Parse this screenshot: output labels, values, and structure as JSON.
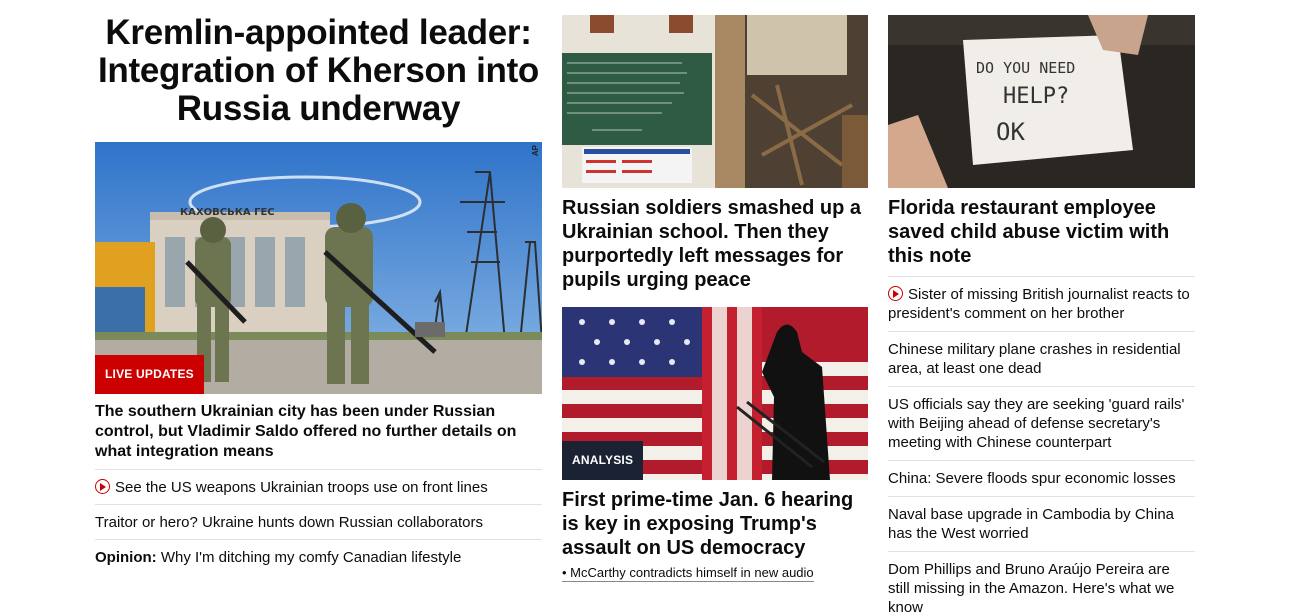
{
  "left": {
    "headline": "Kremlin-appointed leader: Integration of Kherson into Russia underway",
    "badge": "LIVE UPDATES",
    "photo_credit": "AP",
    "photo_sign": "КАХОВСЬКА ГЕС",
    "description": "The southern Ukrainian city has been under Russian control, but Vladimir Saldo offered no further details on what integration means",
    "links": [
      {
        "text": "See the US weapons Ukrainian troops use on front lines",
        "video": true
      },
      {
        "text": "Traitor or hero? Ukraine hunts down Russian collaborators",
        "video": false
      },
      {
        "prefix": "Opinion:",
        "text": " Why I'm ditching my comfy Canadian lifestyle",
        "video": false
      }
    ]
  },
  "middle": {
    "story1": {
      "title": "Russian soldiers smashed up a Ukrainian school. Then they purportedly left messages for pupils urging peace",
      "chalkboard_text": "Россию! ... ",
      "chalkboard_bottom": "Россия!"
    },
    "story2": {
      "badge": "ANALYSIS",
      "title": "First prime-time Jan. 6 hearing is key in exposing Trump's assault on US democracy",
      "sublink": "• McCarthy contradicts himself in new audio"
    }
  },
  "right": {
    "title": "Florida restaurant employee saved child abuse victim with this note",
    "note_lines": [
      "DO YOU NEED",
      "HELP?",
      "OK"
    ],
    "links": [
      {
        "text": "Sister of missing British journalist reacts to president's comment on her brother",
        "video": true
      },
      {
        "text": "Chinese military plane crashes in residential area, at least one dead",
        "video": false
      },
      {
        "text": "US officials say they are seeking 'guard rails' with Beijing ahead of defense secretary's meeting with Chinese counterpart",
        "video": false
      },
      {
        "text": "China: Severe floods spur economic losses",
        "video": false
      },
      {
        "text": "Naval base upgrade in Cambodia by China has the West worried",
        "video": false
      },
      {
        "text": "Dom Phillips and Bruno Araújo Pereira are still missing in the Amazon. Here's what we know",
        "video": false
      }
    ]
  },
  "colors": {
    "live_badge": "#cc0000",
    "analysis_badge": "#1a2233",
    "text": "#0c0c0c",
    "divider": "#e1e1e1"
  }
}
